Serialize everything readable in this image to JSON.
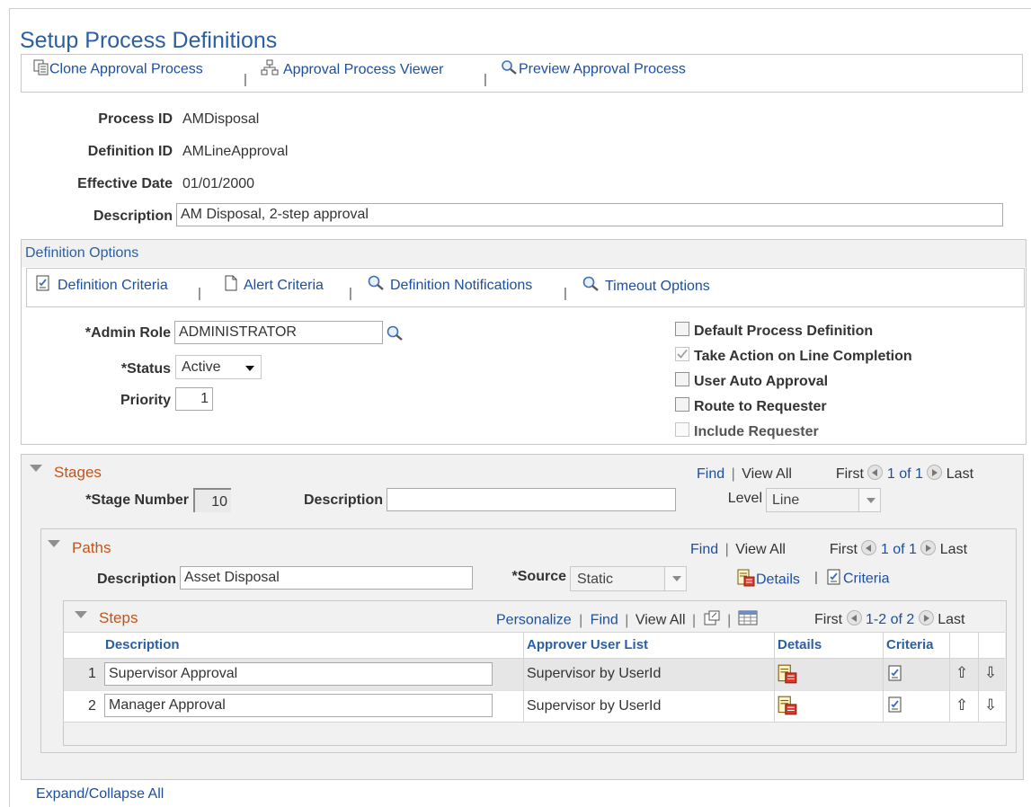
{
  "page": {
    "title": "Setup Process Definitions"
  },
  "toolbar": {
    "clone_label": "Clone Approval Process",
    "viewer_label": "Approval Process Viewer",
    "preview_label": "Preview Approval Process",
    "separator": "|"
  },
  "header": {
    "process_id_label": "Process ID",
    "process_id_value": "AMDisposal",
    "definition_id_label": "Definition ID",
    "definition_id_value": "AMLineApproval",
    "effective_date_label": "Effective Date",
    "effective_date_value": "01/01/2000",
    "description_label": "Description",
    "description_value": "AM Disposal, 2-step approval"
  },
  "definition_options": {
    "title": "Definition Options",
    "links": {
      "criteria": "Definition Criteria",
      "alert": "Alert Criteria",
      "notifications": "Definition Notifications",
      "timeout": "Timeout Options"
    },
    "admin_role_label": "*Admin Role",
    "admin_role_value": "ADMINISTRATOR",
    "status_label": "*Status",
    "status_value": "Active",
    "priority_label": "Priority",
    "priority_value": "1",
    "checkboxes": {
      "default_process": "Default Process Definition",
      "take_action": "Take Action on Line Completion",
      "user_auto_approval": "User Auto Approval",
      "route_to_requester": "Route to Requester",
      "include_requester": "Include Requester"
    }
  },
  "stages": {
    "title": "Stages",
    "find": "Find",
    "view_all": "View All",
    "first": "First",
    "range": "1 of 1",
    "last": "Last",
    "stage_number_label": "*Stage Number",
    "stage_number_value": "10",
    "description_label": "Description",
    "description_value": "",
    "level_label": "Level",
    "level_value": "Line"
  },
  "paths": {
    "title": "Paths",
    "find": "Find",
    "view_all": "View All",
    "first": "First",
    "range": "1 of 1",
    "last": "Last",
    "description_label": "Description",
    "description_value": "Asset Disposal",
    "source_label": "*Source",
    "source_value": "Static",
    "details_link": "Details",
    "criteria_link": "Criteria"
  },
  "steps": {
    "title": "Steps",
    "personalize": "Personalize",
    "find": "Find",
    "view_all": "View All",
    "first": "First",
    "range": "1-2 of 2",
    "last": "Last",
    "columns": {
      "description": "Description",
      "approver": "Approver User List",
      "details": "Details",
      "criteria": "Criteria"
    },
    "rows": [
      {
        "num": "1",
        "description": "Supervisor Approval",
        "approver": "Supervisor by UserId"
      },
      {
        "num": "2",
        "description": "Manager Approval",
        "approver": "Supervisor by UserId"
      }
    ]
  },
  "footer": {
    "expand_collapse": "Expand/Collapse All"
  },
  "icons": {
    "clone": "clone-icon",
    "viewer": "hierarchy-icon",
    "preview": "magnifier-icon",
    "criteria": "criteria-doc-icon",
    "alert": "blank-doc-icon",
    "details": "details-icon",
    "up": "up-arrow-icon",
    "down": "down-arrow-icon"
  },
  "colors": {
    "link": "#1c4fa0",
    "title": "#2b5fa3",
    "section": "#c0551c"
  }
}
